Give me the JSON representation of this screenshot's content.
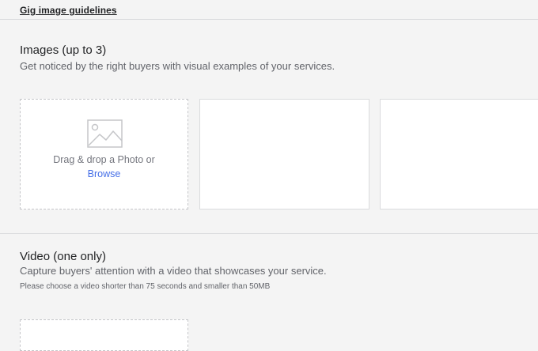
{
  "header": {
    "guidelines_link": "Gig image guidelines"
  },
  "images": {
    "title": "Images (up to 3)",
    "subtitle": "Get noticed by the right buyers with visual examples of your services.",
    "upload": {
      "icon": "image-icon",
      "drop_text": "Drag & drop a Photo or",
      "browse_label": "Browse"
    }
  },
  "video": {
    "title": "Video (one only)",
    "subtitle": "Capture buyers' attention with a video that showcases your service.",
    "note": "Please choose a video shorter than 75 seconds and smaller than 50MB"
  },
  "colors": {
    "background": "#f4f4f4",
    "link": "#446ee7",
    "text": "#404145",
    "muted": "#62646a"
  }
}
